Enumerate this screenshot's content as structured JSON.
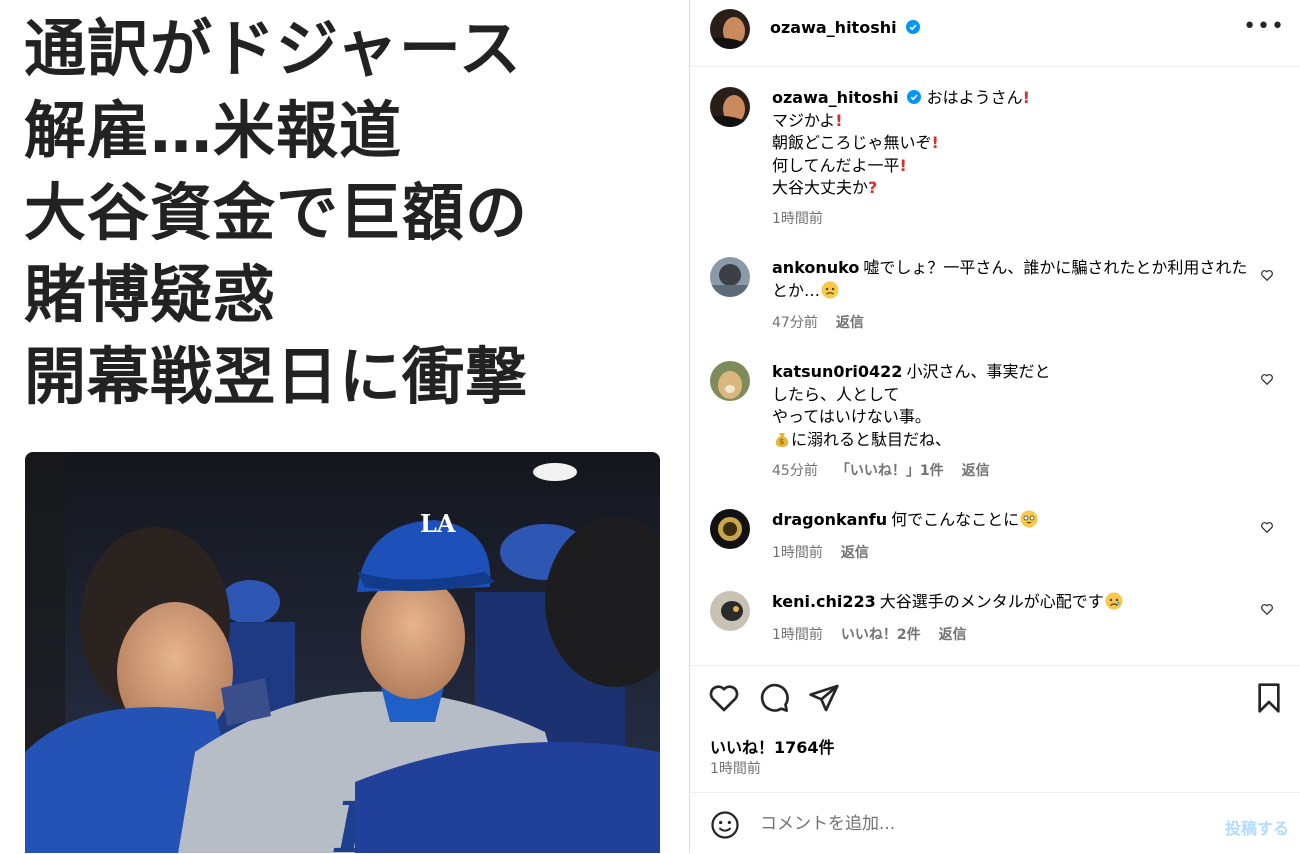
{
  "headline": {
    "lines": [
      "通訳がドジャース",
      "解雇…米報道",
      "大谷資金で巨額の",
      "賭博疑惑",
      "開幕戦翌日に衝撃"
    ]
  },
  "post": {
    "author": "ozawa_hitoshi",
    "caption_lines": [
      "おはようさん",
      "マジかよ",
      "朝飯どころじゃ無いぞ",
      "何してんだよ一平",
      "大谷大丈夫か"
    ],
    "time": "1時間前",
    "likes": "いいね！1764件",
    "post_time": "1時間前"
  },
  "comments": [
    {
      "user": "ankonuko",
      "text": "嘘でしょ？一平さん、誰かに騙されたとか利用されたとか…",
      "time": "47分前",
      "likes": "",
      "reply": "返信"
    },
    {
      "user": "katsun0ri0422",
      "lines": [
        "小沢さん、事実だと",
        "したら、人として",
        "やってはいけない事。",
        "に溺れると駄目だね、"
      ],
      "time": "45分前",
      "likes": "「いいね！」1件",
      "reply": "返信"
    },
    {
      "user": "dragonkanfu",
      "text": "何でこんなことに",
      "time": "1時間前",
      "likes": "",
      "reply": "返信"
    },
    {
      "user": "keni.chi223",
      "text": "大谷選手のメンタルが心配です",
      "time": "1時間前",
      "likes": "いいね！2件",
      "reply": "返信"
    }
  ],
  "comment_box": {
    "placeholder": "コメントを追加...",
    "submit": "投稿する"
  },
  "icons": [
    "verified-badge-icon",
    "more-options-icon",
    "heart-icon",
    "comment-icon",
    "share-icon",
    "bookmark-icon",
    "emoji-icon"
  ],
  "colors": {
    "verified": "#0095f6",
    "link_disabled": "#b3dbff",
    "muted": "#737373",
    "dodger_blue": "#2a4a9a"
  }
}
